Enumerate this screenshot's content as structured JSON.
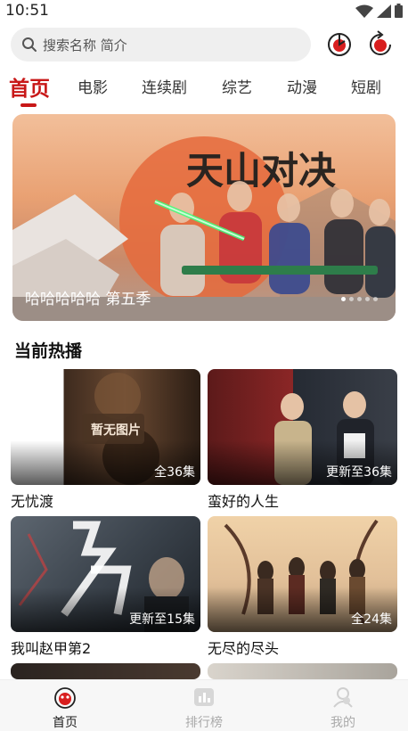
{
  "status_bar": {
    "time": "10:51"
  },
  "search": {
    "placeholder": "搜索名称 简介"
  },
  "tabs": [
    {
      "label": "首页",
      "active": true
    },
    {
      "label": "电影"
    },
    {
      "label": "连续剧"
    },
    {
      "label": "综艺"
    },
    {
      "label": "动漫"
    },
    {
      "label": "短剧"
    }
  ],
  "banner": {
    "caption": "哈哈哈哈哈 第五季",
    "logo_text": "天山对决"
  },
  "section": {
    "title": "当前热播"
  },
  "cards": [
    {
      "title": "无忧渡",
      "badge": "全36集",
      "placeholder_text": "暂无图片"
    },
    {
      "title": "蛮好的人生",
      "badge": "更新至36集"
    },
    {
      "title": "我叫赵甲第2",
      "badge": "更新至15集"
    },
    {
      "title": "无尽的尽头",
      "badge": "全24集"
    }
  ],
  "bottom_nav": [
    {
      "label": "首页",
      "icon": "home-icon",
      "active": true
    },
    {
      "label": "排行榜",
      "icon": "ranking-icon"
    },
    {
      "label": "我的",
      "icon": "profile-icon"
    }
  ],
  "colors": {
    "accent": "#c81818",
    "search_bg": "#efefef"
  }
}
